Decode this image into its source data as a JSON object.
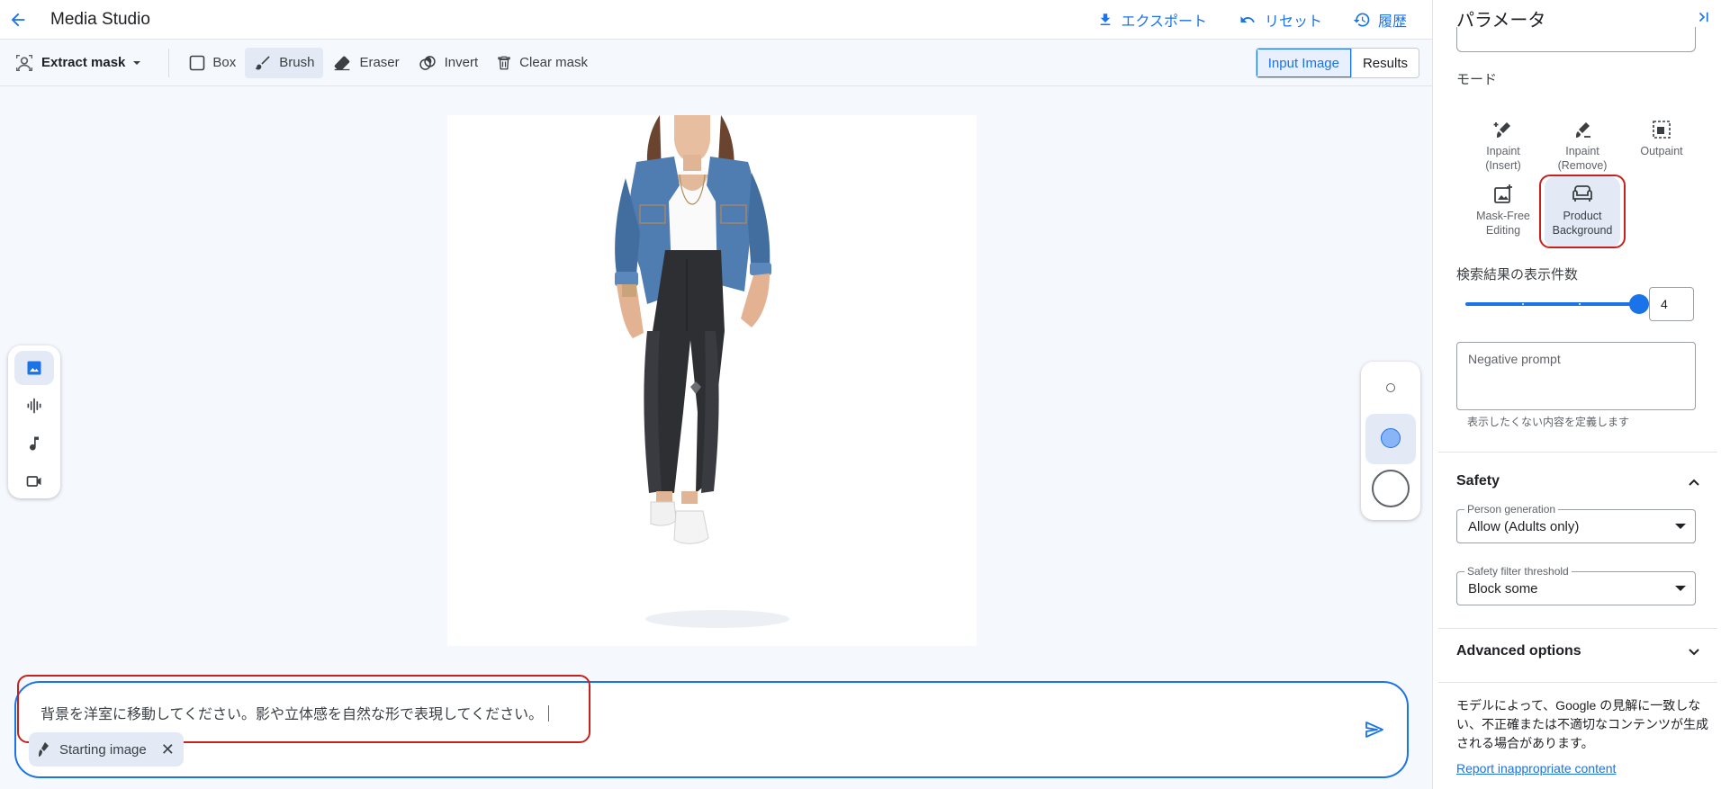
{
  "header": {
    "title": "Media Studio",
    "export_label": "エクスポート",
    "reset_label": "リセット",
    "history_label": "履歴"
  },
  "toolbar": {
    "extract_mask_label": "Extract mask",
    "box_label": "Box",
    "brush_label": "Brush",
    "eraser_label": "Eraser",
    "invert_label": "Invert",
    "clear_mask_label": "Clear mask",
    "view_tabs": [
      "Input Image",
      "Results"
    ],
    "active_view": "Input Image",
    "active_tool": "Brush"
  },
  "left_rail": {
    "items": [
      "image-icon",
      "audio-wave-icon",
      "music-note-icon",
      "video-icon"
    ],
    "active": "image-icon"
  },
  "brush_sizes": {
    "options": [
      "small",
      "medium",
      "large"
    ],
    "selected": "medium"
  },
  "prompt": {
    "text": "背景を洋室に移動してください。影や立体感を自然な形で表現してください。",
    "chip_label": "Starting image"
  },
  "panel": {
    "title": "パラメータ",
    "mode_label": "モード",
    "modes": [
      {
        "line1": "Inpaint",
        "line2": "(Insert)"
      },
      {
        "line1": "Inpaint",
        "line2": "(Remove)"
      },
      {
        "line1": "Outpaint",
        "line2": ""
      },
      {
        "line1": "Mask-Free",
        "line2": "Editing"
      },
      {
        "line1": "Product",
        "line2": "Background"
      }
    ],
    "selected_mode": "Product Background",
    "result_count_label": "検索結果の表示件数",
    "result_count_value": "4",
    "result_count_fraction": 1.0,
    "negative_prompt_placeholder": "Negative prompt",
    "negative_prompt_hint": "表示したくない内容を定義します",
    "safety_title": "Safety",
    "person_generation_label": "Person generation",
    "person_generation_value": "Allow (Adults only)",
    "safety_filter_label": "Safety filter threshold",
    "safety_filter_value": "Block some",
    "advanced_title": "Advanced options",
    "disclaimer": "モデルによって、Google の見解に一致しない、不正確または不適切なコンテンツが生成される場合があります。",
    "report_link": "Report inappropriate content"
  },
  "colors": {
    "accent": "#1a73e8",
    "highlight": "#c5221f",
    "canvas_bg": "#f5f8fd"
  }
}
